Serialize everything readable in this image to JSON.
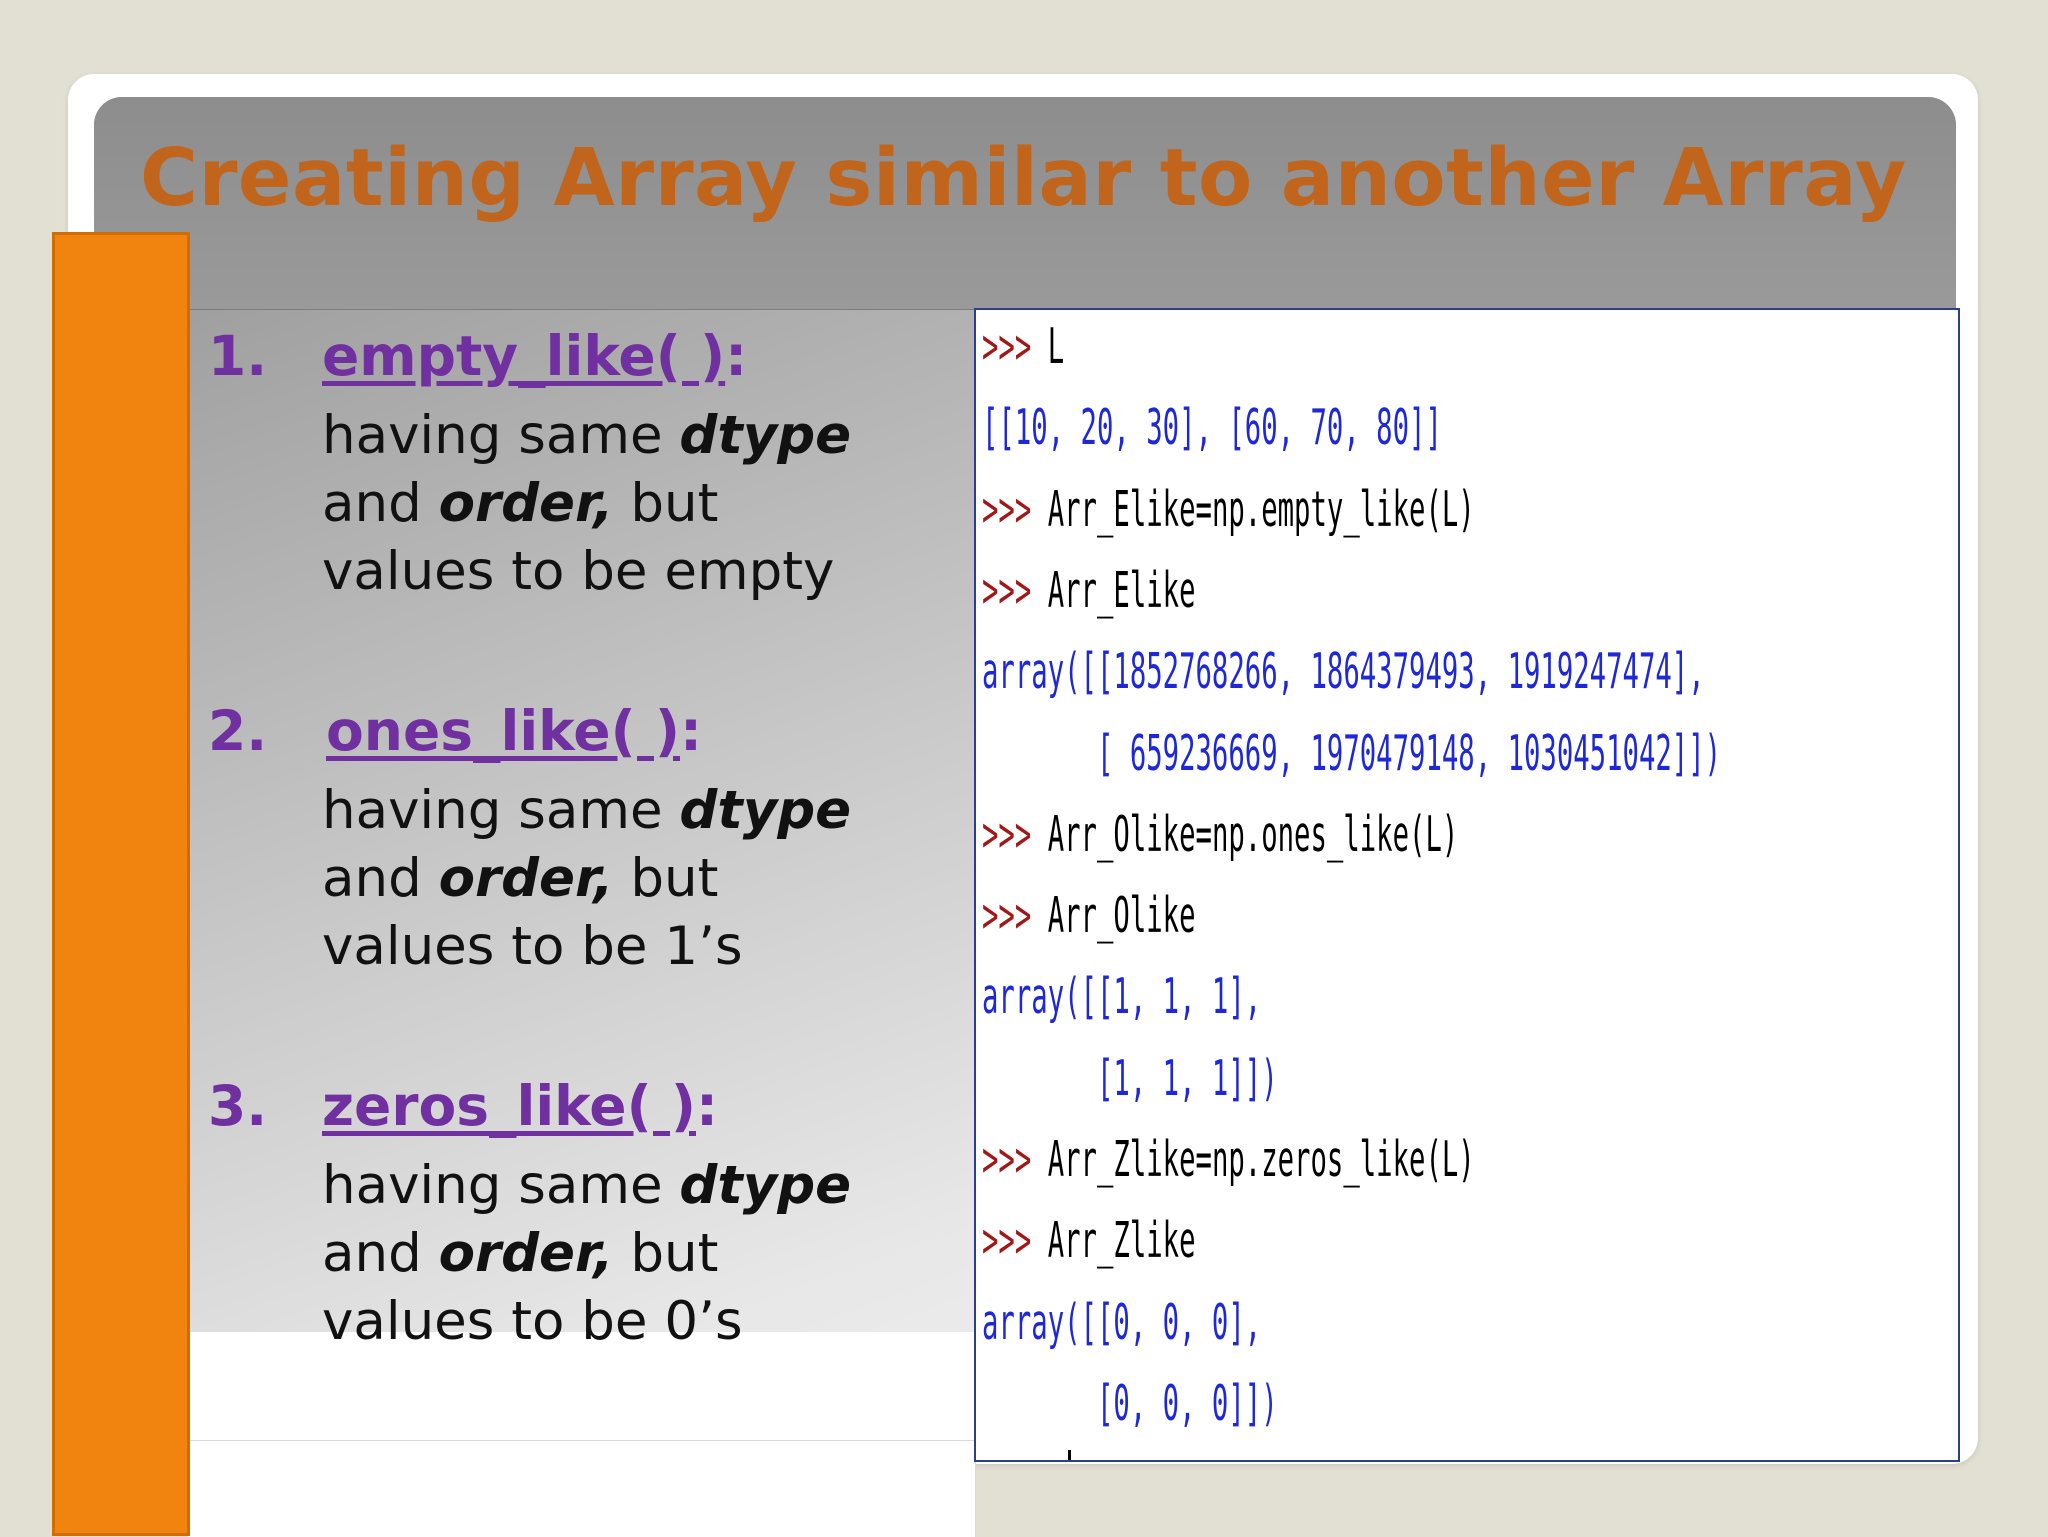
{
  "slide": {
    "title": "Creating Array similar to another Array"
  },
  "items": [
    {
      "number": "1.",
      "function": "empty_like( )",
      "colon": ":",
      "line1_plain": "having same ",
      "line1_bold": "dtype",
      "line2_pre": "and ",
      "line2_bold": "order,",
      "line2_post": " but",
      "line3": "values to be empty"
    },
    {
      "number": "2.",
      "function": "ones_like( )",
      "colon": ":",
      "line1_plain": "having same ",
      "line1_bold": "dtype",
      "line2_pre": "and ",
      "line2_bold": "order,",
      "line2_post": " but",
      "line3": "values to be 1’s"
    },
    {
      "number": "3.",
      "function": "zeros_like( )",
      "colon": ":",
      "line1_plain": "having same ",
      "line1_bold": "dtype",
      "line2_pre": "and ",
      "line2_bold": "order,",
      "line2_post": " but",
      "line3": "values to be 0’s"
    }
  ],
  "console": {
    "prompt": ">>>",
    "lines": [
      {
        "kind": "cmd",
        "text": "L"
      },
      {
        "kind": "out",
        "text": "[[10, 20, 30], [60, 70, 80]]"
      },
      {
        "kind": "cmd",
        "text": "Arr_Elike=np.empty_like(L)"
      },
      {
        "kind": "cmd",
        "text": "Arr_Elike"
      },
      {
        "kind": "out",
        "text": "array([[1852768266, 1864379493, 1919247474],"
      },
      {
        "kind": "out",
        "text": "       [ 659236669, 1970479148, 1030451042]])"
      },
      {
        "kind": "cmd",
        "text": "Arr_Olike=np.ones_like(L)"
      },
      {
        "kind": "cmd",
        "text": "Arr_Olike"
      },
      {
        "kind": "out",
        "text": "array([[1, 1, 1],"
      },
      {
        "kind": "out",
        "text": "       [1, 1, 1]])"
      },
      {
        "kind": "cmd",
        "text": "Arr_Zlike=np.zeros_like(L)"
      },
      {
        "kind": "cmd",
        "text": "Arr_Zlike"
      },
      {
        "kind": "out",
        "text": "array([[0, 0, 0],"
      },
      {
        "kind": "out",
        "text": "       [0, 0, 0]])"
      }
    ]
  },
  "colors": {
    "title": "#c0651b",
    "accent_bar": "#f0840f",
    "item_heading": "#7030a0",
    "console_prompt": "#a01818",
    "console_output": "#1e28d6",
    "console_border": "#2b3f8f"
  }
}
